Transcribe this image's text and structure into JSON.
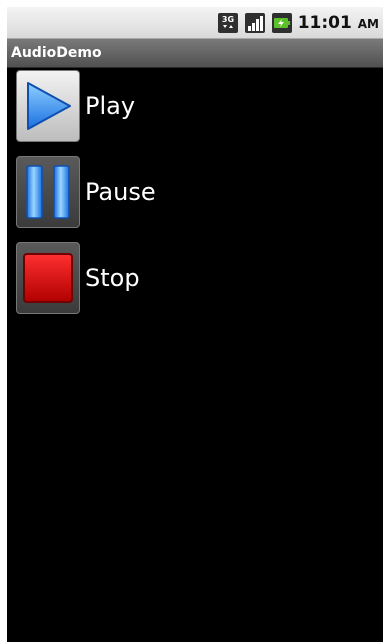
{
  "status_bar": {
    "network_label": "3G",
    "time": "11:01",
    "ampm": "AM",
    "icons": [
      "network-3g-icon",
      "signal-strength-icon",
      "battery-charging-icon"
    ]
  },
  "title_bar": {
    "title": "AudioDemo"
  },
  "buttons": [
    {
      "label": "Play",
      "icon": "play-icon"
    },
    {
      "label": "Pause",
      "icon": "pause-icon"
    },
    {
      "label": "Stop",
      "icon": "stop-icon"
    }
  ]
}
